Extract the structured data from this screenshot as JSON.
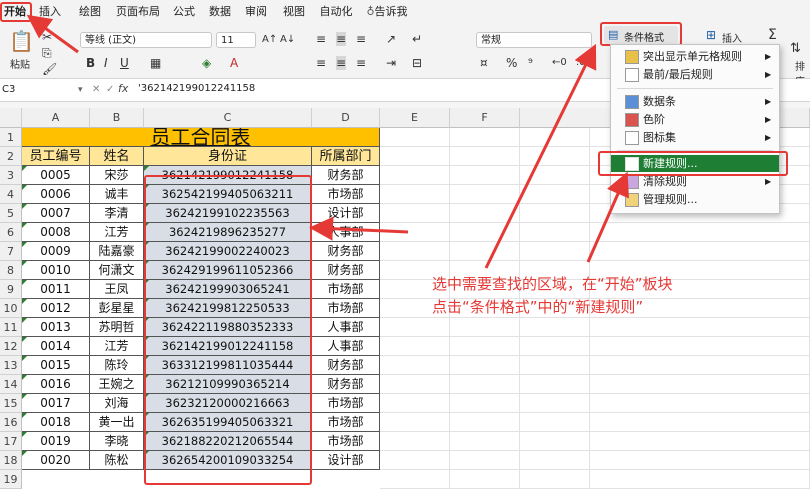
{
  "ribbon": {
    "tabs": [
      "开始",
      "插入",
      "绘图",
      "页面布局",
      "公式",
      "数据",
      "审阅",
      "视图",
      "自动化",
      "告诉我"
    ],
    "paste_label": "粘贴",
    "font_name": "等线 (正文)",
    "font_size": "11",
    "number_format": "常规",
    "cond_format": "条件格式",
    "insert_label": "插入",
    "sort_label": "排序"
  },
  "formula_bar": {
    "name_box": "C3",
    "fx": "fx",
    "formula": "'362142199012241158"
  },
  "columns": [
    "A",
    "B",
    "C",
    "D",
    "E",
    "F",
    "G"
  ],
  "rows": [
    "1",
    "2",
    "3",
    "4",
    "5",
    "6",
    "7",
    "8",
    "9",
    "10",
    "11",
    "12",
    "13",
    "14",
    "15",
    "16",
    "17",
    "18",
    "19"
  ],
  "sheet": {
    "title": "员工合同表",
    "headers": [
      "员工编号",
      "姓名",
      "身份证",
      "所属部门"
    ],
    "records": [
      [
        "0005",
        "宋莎",
        "362142199012241158",
        "财务部"
      ],
      [
        "0006",
        "诚丰",
        "362542199405063211",
        "市场部"
      ],
      [
        "0007",
        "李清",
        "36242199102235563",
        "设计部"
      ],
      [
        "0008",
        "江芳",
        "3624219896235277",
        "人事部"
      ],
      [
        "0009",
        "陆嘉豪",
        "36242199002240023",
        "财务部"
      ],
      [
        "0010",
        "何潇文",
        "362429199611052366",
        "财务部"
      ],
      [
        "0011",
        "王凤",
        "36242199903065241",
        "市场部"
      ],
      [
        "0012",
        "彭星星",
        "36242199812250533",
        "市场部"
      ],
      [
        "0013",
        "苏明哲",
        "362422119880352333",
        "人事部"
      ],
      [
        "0014",
        "江芳",
        "362142199012241158",
        "人事部"
      ],
      [
        "0015",
        "陈玲",
        "363312199811035444",
        "财务部"
      ],
      [
        "0016",
        "王婉之",
        "36212109990365214",
        "财务部"
      ],
      [
        "0017",
        "刘海",
        "36232120000216663",
        "市场部"
      ],
      [
        "0018",
        "黄一出",
        "362635199405063321",
        "市场部"
      ],
      [
        "0019",
        "李晓",
        "362188220212065544",
        "市场部"
      ],
      [
        "0020",
        "陈松",
        "362654200109033254",
        "设计部"
      ]
    ]
  },
  "menu": {
    "items": [
      {
        "label": "突出显示单元格规则",
        "arrow": "▶"
      },
      {
        "label": "最前/最后规则",
        "arrow": "▶"
      },
      {
        "label": "数据条",
        "arrow": "▶"
      },
      {
        "label": "色阶",
        "arrow": "▶"
      },
      {
        "label": "图标集",
        "arrow": "▶"
      },
      {
        "label": "新建规则...",
        "arrow": ""
      },
      {
        "label": "清除规则",
        "arrow": "▶"
      },
      {
        "label": "管理规则...",
        "arrow": ""
      }
    ]
  },
  "annotation": {
    "line1": "选中需要查找的区域，在“开始”板块",
    "line2": "点击“条件格式”中的“新建规则”"
  },
  "colors": {
    "accent_red": "#e53935",
    "title_fill": "#ffc000",
    "header_fill": "#ffe699",
    "selection_fill": "#d9dde6",
    "highlight_green": "#1e7e34"
  }
}
